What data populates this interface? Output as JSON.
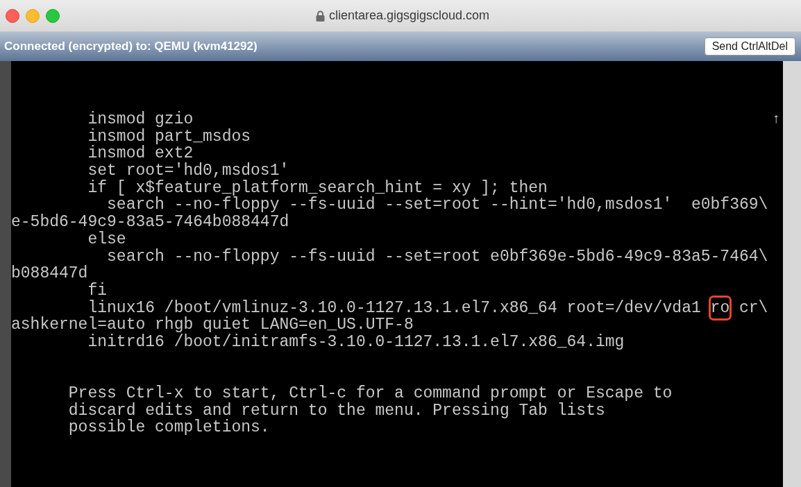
{
  "window": {
    "title": "clientarea.gigsgigscloud.com"
  },
  "toolbar": {
    "status": "Connected (encrypted) to: QEMU (kvm41292)",
    "button": "Send CtrlAltDel"
  },
  "console": {
    "scroll_indicator": "↑",
    "editor_lines": [
      {
        "kind": "plain",
        "text": "        insmod gzio"
      },
      {
        "kind": "plain",
        "text": "        insmod part_msdos"
      },
      {
        "kind": "plain",
        "text": "        insmod ext2"
      },
      {
        "kind": "plain",
        "text": "        set root='hd0,msdos1'"
      },
      {
        "kind": "plain",
        "text": "        if [ x$feature_platform_search_hint = xy ]; then"
      },
      {
        "kind": "plain",
        "text": "          search --no-floppy --fs-uuid --set=root --hint='hd0,msdos1'  e0bf369\\"
      },
      {
        "kind": "plain",
        "text": "e-5bd6-49c9-83a5-7464b088447d"
      },
      {
        "kind": "plain",
        "text": "        else"
      },
      {
        "kind": "plain",
        "text": "          search --no-floppy --fs-uuid --set=root e0bf369e-5bd6-49c9-83a5-7464\\"
      },
      {
        "kind": "plain",
        "text": "b088447d"
      },
      {
        "kind": "plain",
        "text": "        fi"
      },
      {
        "kind": "marked",
        "before": "        linux16 /boot/vmlinuz-3.10.0-1127.13.1.el7.x86_64 root=/dev/vda1 ",
        "mark": "ro",
        "after": " cr\\"
      },
      {
        "kind": "plain",
        "text": "ashkernel=auto rhgb quiet LANG=en_US.UTF-8"
      },
      {
        "kind": "plain",
        "text": "        initrd16 /boot/initramfs-3.10.0-1127.13.1.el7.x86_64.img"
      }
    ],
    "help_lines": [
      "      Press Ctrl-x to start, Ctrl-c for a command prompt or Escape to",
      "      discard edits and return to the menu. Pressing Tab lists",
      "      possible completions."
    ]
  }
}
